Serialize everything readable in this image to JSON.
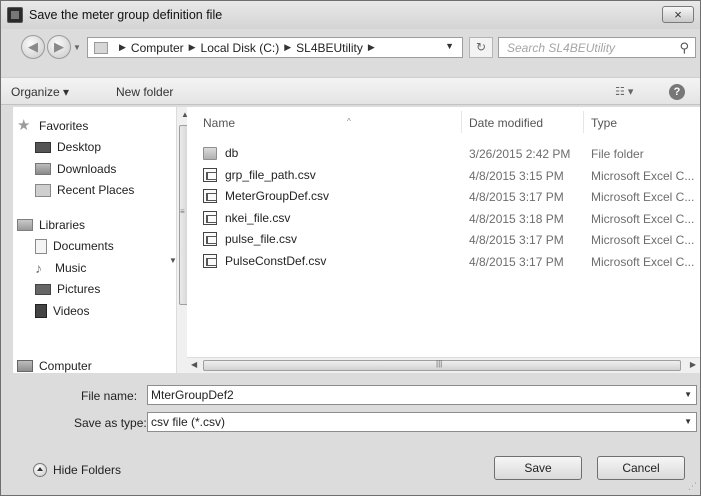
{
  "window": {
    "title": "Save the meter group definition file",
    "close_label": "×"
  },
  "address": {
    "crumbs": [
      "Computer",
      "Local Disk (C:)",
      "SL4BEUtility"
    ],
    "search_placeholder": "Search SL4BEUtility"
  },
  "toolbar": {
    "organize_label": "Organize ▾",
    "new_folder_label": "New folder",
    "help_label": "?"
  },
  "nav": {
    "favorites": "Favorites",
    "desktop": "Desktop",
    "downloads": "Downloads",
    "recent_places": "Recent Places",
    "libraries": "Libraries",
    "documents": "Documents",
    "music": "Music",
    "pictures": "Pictures",
    "videos": "Videos",
    "computer": "Computer"
  },
  "columns": {
    "name": "Name",
    "date": "Date modified",
    "type": "Type"
  },
  "files": [
    {
      "name": "db",
      "date": "3/26/2015 2:42 PM",
      "type": "File folder",
      "kind": "folder"
    },
    {
      "name": "grp_file_path.csv",
      "date": "4/8/2015 3:15 PM",
      "type": "Microsoft Excel C...",
      "kind": "csv"
    },
    {
      "name": "MeterGroupDef.csv",
      "date": "4/8/2015 3:17 PM",
      "type": "Microsoft Excel C...",
      "kind": "csv"
    },
    {
      "name": "nkei_file.csv",
      "date": "4/8/2015 3:18 PM",
      "type": "Microsoft Excel C...",
      "kind": "csv"
    },
    {
      "name": "pulse_file.csv",
      "date": "4/8/2015 3:17 PM",
      "type": "Microsoft Excel C...",
      "kind": "csv"
    },
    {
      "name": "PulseConstDef.csv",
      "date": "4/8/2015 3:17 PM",
      "type": "Microsoft Excel C...",
      "kind": "csv"
    }
  ],
  "form": {
    "file_name_label": "File name:",
    "file_name_value": "MterGroupDef2",
    "save_as_type_label": "Save as type:",
    "save_as_type_value": "csv file (*.csv)"
  },
  "bottom": {
    "hide_folders_label": "Hide Folders",
    "save_label": "Save",
    "cancel_label": "Cancel"
  }
}
